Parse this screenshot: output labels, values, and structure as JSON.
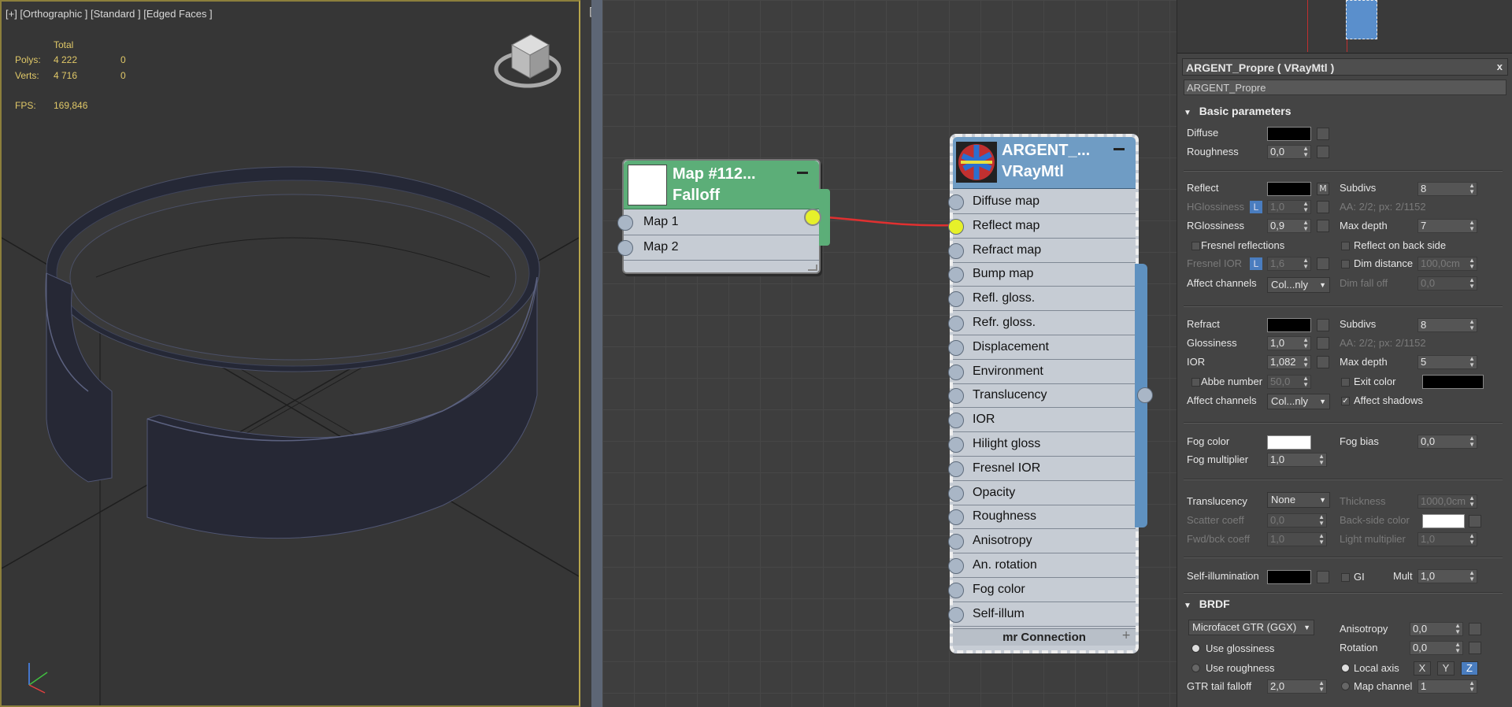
{
  "viewport": {
    "label": "[+] [Orthographic ] [Standard ] [Edged Faces ]",
    "stats": {
      "total_label": "Total",
      "polys_label": "Polys:",
      "polys_total": "4 222",
      "polys_sel": "0",
      "verts_label": "Verts:",
      "verts_total": "4 716",
      "verts_sel": "0",
      "fps_label": "FPS:",
      "fps_value": "169,846"
    },
    "viewcube_icon": "viewcube-icon",
    "axis_icon": "axis-tripod-icon",
    "colors": {
      "border": "#b8a64b",
      "stats": "#e0c868",
      "background": "#363636"
    }
  },
  "separator_bracket": "[",
  "node_editor": {
    "falloff_node": {
      "title": "Map #112...",
      "subtitle": "Falloff",
      "slots": [
        "Map 1",
        "Map 2"
      ],
      "header_color": "#5cae78"
    },
    "material_node": {
      "title": "ARGENT_...",
      "subtitle": "VRayMtl",
      "header_color": "#6f9cc4",
      "slots": [
        "Diffuse map",
        "Reflect map",
        "Refract map",
        "Bump map",
        "Refl. gloss.",
        "Refr. gloss.",
        "Displacement",
        "Environment",
        "Translucency",
        "IOR",
        "Hilight gloss",
        "Fresnel IOR",
        "Opacity",
        "Roughness",
        "Anisotropy",
        "An. rotation",
        "Fog color",
        "Self-illum"
      ],
      "footer": "mr Connection",
      "connected_slot": "Reflect map"
    },
    "wire_color": "#e03030",
    "socket_active_color": "#e6f02a"
  },
  "panel": {
    "title": "ARGENT_Propre  ( VRayMtl )",
    "close": "x",
    "name_value": "ARGENT_Propre",
    "basic_params": {
      "heading": "Basic parameters",
      "diffuse_label": "Diffuse",
      "roughness_label": "Roughness",
      "roughness_value": "0,0",
      "reflect_label": "Reflect",
      "reflect_m": "M",
      "subdivs_label": "Subdivs",
      "subdivs_value": "8",
      "hglossiness_label": "HGlossiness",
      "hglossiness_l": "L",
      "hglossiness_value": "1,0",
      "aa_text": "AA: 2/2; px: 2/1152",
      "rglossiness_label": "RGlossiness",
      "rglossiness_value": "0,9",
      "max_depth_label": "Max depth",
      "max_depth_value": "7",
      "fresnel_label": "Fresnel reflections",
      "reflect_back_label": "Reflect on back side",
      "fresnel_ior_label": "Fresnel IOR",
      "fresnel_ior_l": "L",
      "fresnel_ior_value": "1,6",
      "dim_distance_label": "Dim distance",
      "dim_distance_value": "100,0cm",
      "affect_channels_label": "Affect channels",
      "affect_channels_value": "Col...nly",
      "dim_falloff_label": "Dim fall off",
      "dim_falloff_value": "0,0",
      "refract_label": "Refract",
      "refract_subdivs_label": "Subdivs",
      "refract_subdivs_value": "8",
      "glossiness_label": "Glossiness",
      "glossiness_value": "1,0",
      "refract_aa_text": "AA: 2/2; px: 2/1152",
      "ior_label": "IOR",
      "ior_value": "1,082",
      "refract_max_depth_label": "Max depth",
      "refract_max_depth_value": "5",
      "abbe_label": "Abbe number",
      "abbe_value": "50,0",
      "exit_color_label": "Exit color",
      "refract_affect_label": "Affect channels",
      "refract_affect_value": "Col...nly",
      "affect_shadows_label": "Affect shadows",
      "fog_color_label": "Fog color",
      "fog_bias_label": "Fog bias",
      "fog_bias_value": "0,0",
      "fog_mult_label": "Fog multiplier",
      "fog_mult_value": "1,0",
      "translucency_label": "Translucency",
      "translucency_value": "None",
      "thickness_label": "Thickness",
      "thickness_value": "1000,0cm",
      "scatter_label": "Scatter coeff",
      "scatter_value": "0,0",
      "backside_label": "Back-side color",
      "fwd_label": "Fwd/bck coeff",
      "fwd_value": "1,0",
      "light_mult_label": "Light multiplier",
      "light_mult_value": "1,0",
      "self_illum_label": "Self-illumination",
      "gi_label": "GI",
      "mult_label": "Mult",
      "mult_value": "1,0"
    },
    "brdf": {
      "heading": "BRDF",
      "type_value": "Microfacet GTR (GGX)",
      "anisotropy_label": "Anisotropy",
      "anisotropy_value": "0,0",
      "use_gloss_label": "Use glossiness",
      "rotation_label": "Rotation",
      "rotation_value": "0,0",
      "use_rough_label": "Use roughness",
      "local_axis_label": "Local axis",
      "x": "X",
      "y": "Y",
      "z": "Z",
      "gtr_label": "GTR tail falloff",
      "gtr_value": "2,0",
      "map_channel_label": "Map channel",
      "map_channel_value": "1"
    }
  }
}
